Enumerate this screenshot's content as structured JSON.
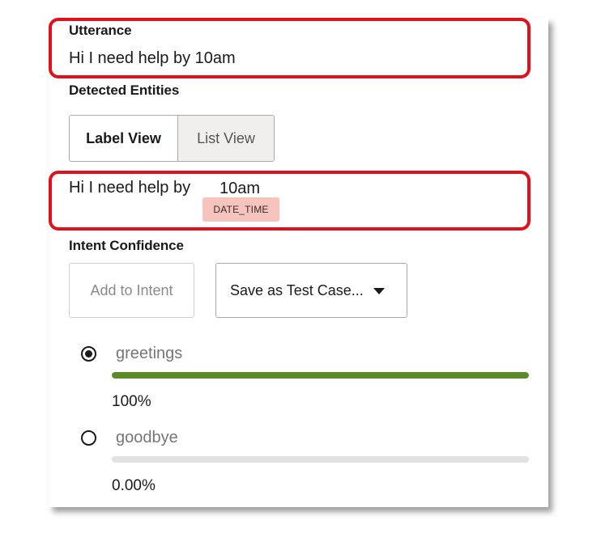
{
  "utterance": {
    "title": "Utterance",
    "text": "Hi I need help by 10am"
  },
  "detected_entities": {
    "title": "Detected Entities",
    "view_toggle": {
      "options": [
        "Label View",
        "List View"
      ],
      "selected": "Label View"
    },
    "label_view": {
      "prefix": "Hi I need help by",
      "entity_text": "10am",
      "entity_tag": "DATE_TIME",
      "tag_color": "#f7c3bd"
    }
  },
  "intent_confidence": {
    "title": "Intent Confidence",
    "add_to_intent_label": "Add to Intent",
    "save_test_case_label": "Save as Test Case...",
    "intents": [
      {
        "name": "greetings",
        "selected": true,
        "confidence": 1.0,
        "percent_label": "100%",
        "bar_color": "#5a8a2a"
      },
      {
        "name": "goodbye",
        "selected": false,
        "confidence": 0.0,
        "percent_label": "0.00%",
        "bar_color": "#5a8a2a"
      }
    ]
  },
  "highlight_color": "#e0111a",
  "icons": {
    "dropdown": "caret-down-icon",
    "radio_selected": "radio-selected-icon",
    "radio_unselected": "radio-unselected-icon"
  }
}
